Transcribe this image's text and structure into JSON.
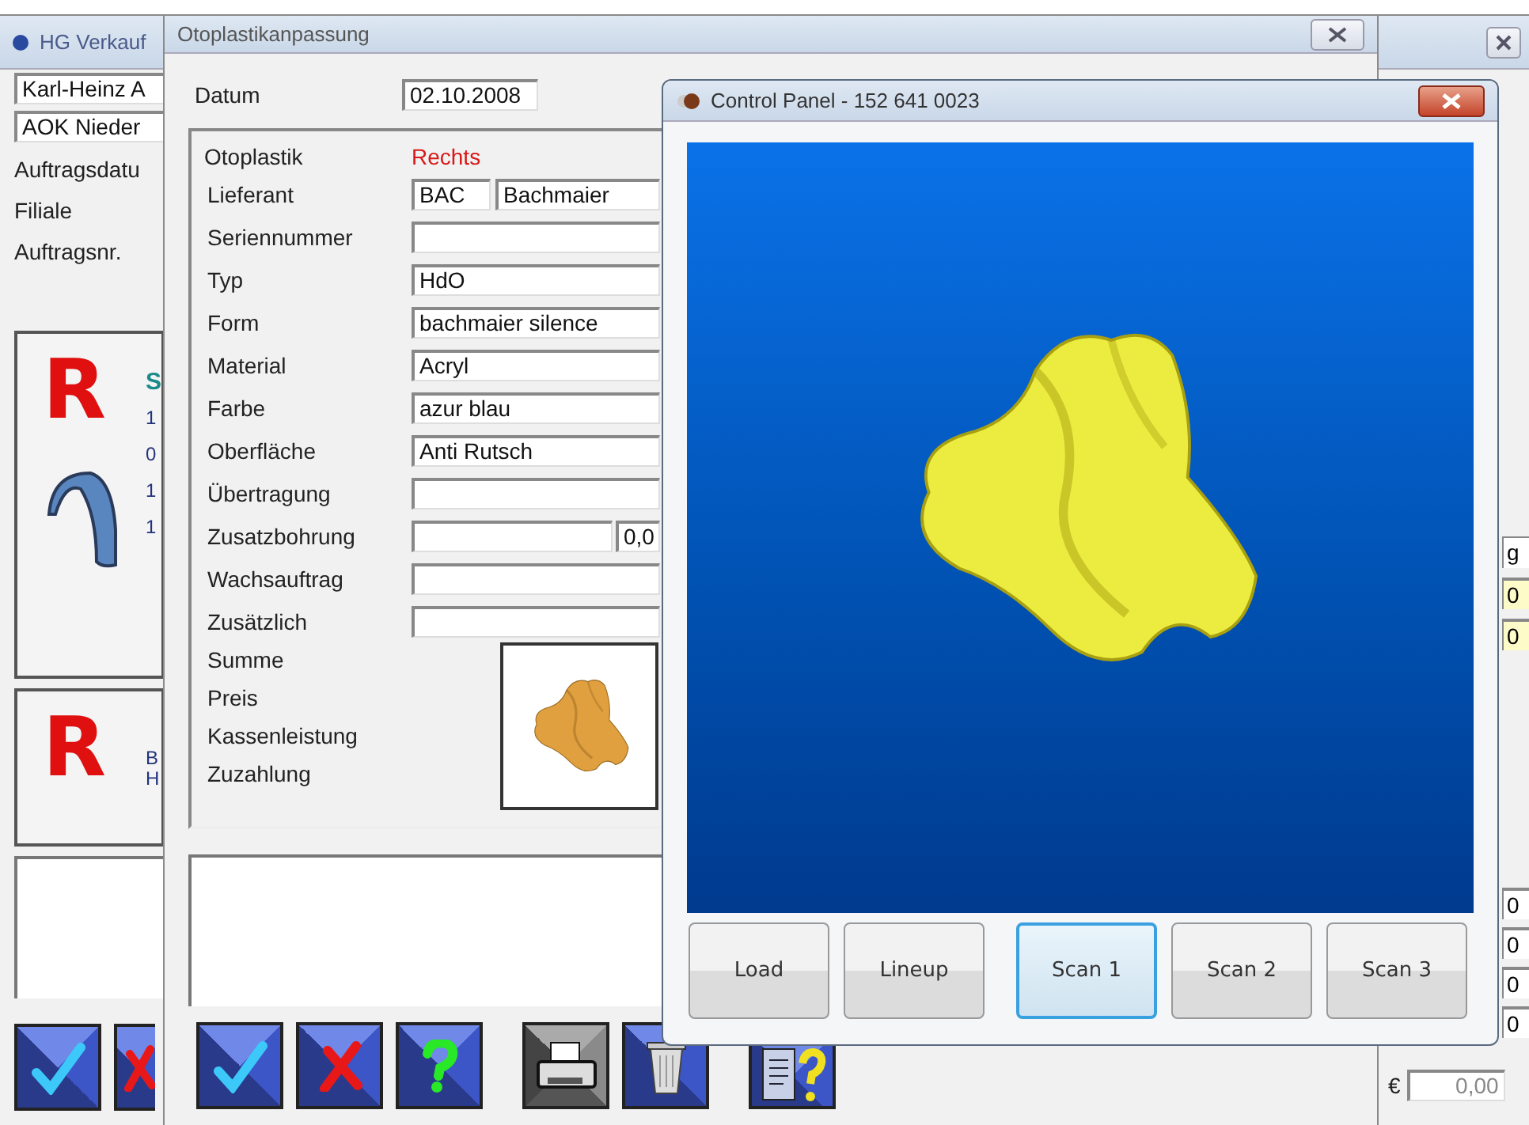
{
  "back_window": {
    "title": "HG Verkauf",
    "name_field": "Karl-Heinz A",
    "insurer_field": "AOK Nieder",
    "labels": [
      "Auftragsdatu",
      "Filiale",
      "Auftragsnr."
    ],
    "cards": [
      {
        "mark": "R",
        "lines": [
          "S",
          "1",
          "0",
          "1",
          "1"
        ],
        "device": true
      },
      {
        "mark": "R",
        "lines": [
          "B",
          "H"
        ],
        "device": false
      }
    ],
    "toolbar": [
      {
        "kind": "confirm"
      },
      {
        "kind": "cancel"
      }
    ],
    "side_column": {
      "header": "g",
      "highlighted_values": [
        "0",
        "0"
      ],
      "values": [
        "0",
        "0",
        "0",
        "0"
      ],
      "currency": "€",
      "total": "0,00"
    }
  },
  "form_window": {
    "title": "Otoplastikanpassung",
    "date_label": "Datum",
    "date": "02.10.2008",
    "section": "Otoplastik",
    "side": "Rechts",
    "rows": [
      {
        "kind": "code",
        "label": "Lieferant",
        "code": "BAC",
        "value": "Bachmaier"
      },
      {
        "kind": "field",
        "label": "Seriennummer"
      },
      {
        "kind": "field",
        "label": "Typ",
        "value": "HdO"
      },
      {
        "kind": "field",
        "label": "Form",
        "value": "bachmaier silence"
      },
      {
        "kind": "field",
        "label": "Material",
        "value": "Acryl"
      },
      {
        "kind": "field",
        "label": "Farbe",
        "value": "azur blau"
      },
      {
        "kind": "field",
        "label": "Oberfläche",
        "value": "Anti Rutsch"
      },
      {
        "kind": "field",
        "label": "Übertragung"
      },
      {
        "kind": "split",
        "label": "Zusatzbohrung",
        "extra": "0,0"
      },
      {
        "kind": "field",
        "label": "Wachsauftrag"
      },
      {
        "kind": "field",
        "label": "Zusätzlich"
      }
    ],
    "totals": [
      "Summe",
      "Preis",
      "Kassenleistung",
      "Zuzahlung"
    ],
    "toolbar": [
      [
        {
          "kind": "confirm"
        },
        {
          "kind": "cancel"
        },
        {
          "kind": "help"
        }
      ],
      [
        {
          "kind": "print"
        },
        {
          "kind": "delete"
        }
      ],
      [
        {
          "kind": "document_help"
        }
      ]
    ]
  },
  "control_panel": {
    "title": "Control Panel - 152 641 0023",
    "buttons": [
      {
        "label": "Load",
        "selected": false
      },
      {
        "label": "Lineup",
        "selected": false
      },
      {
        "label": "Scan 1",
        "selected": true
      },
      {
        "label": "Scan 2",
        "selected": false
      },
      {
        "label": "Scan 3",
        "selected": false
      }
    ]
  }
}
